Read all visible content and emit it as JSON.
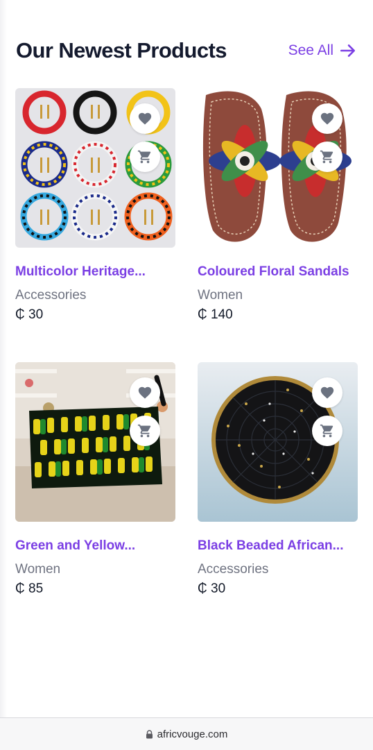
{
  "header": {
    "title": "Our Newest Products",
    "see_all_label": "See All"
  },
  "products": [
    {
      "name": "Multicolor Heritage...",
      "category": "Accessories",
      "price": "₵ 30"
    },
    {
      "name": "Coloured Floral Sandals",
      "category": "Women",
      "price": "₵ 140"
    },
    {
      "name": "Green and Yellow...",
      "category": "Women",
      "price": "₵ 85"
    },
    {
      "name": "Black Beaded African...",
      "category": "Accessories",
      "price": "₵ 30"
    }
  ],
  "browser": {
    "url": "africvouge.com"
  },
  "colors": {
    "accent": "#7b3fe4",
    "title": "#141a2e",
    "muted": "#6e7280",
    "icon": "#6b7280"
  }
}
